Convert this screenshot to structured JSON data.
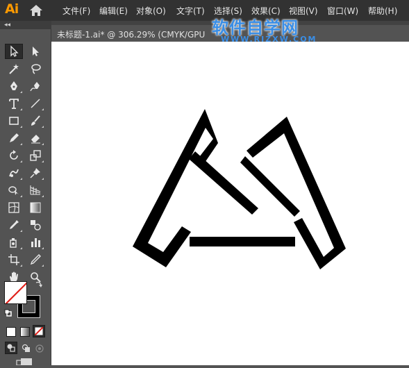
{
  "app": {
    "logo_text": "Ai"
  },
  "menu": {
    "items": [
      {
        "label": "文件(F)"
      },
      {
        "label": "编辑(E)"
      },
      {
        "label": "对象(O)"
      },
      {
        "label": "文字(T)"
      },
      {
        "label": "选择(S)"
      },
      {
        "label": "效果(C)"
      },
      {
        "label": "视图(V)"
      },
      {
        "label": "窗口(W)"
      },
      {
        "label": "帮助(H)"
      }
    ]
  },
  "document": {
    "tab_title": "未标题-1.ai* @ 306.29% (CMYK/GPU"
  },
  "watermark": {
    "main": "软件自学网",
    "url": "WWW.RJZXW.COM"
  },
  "tools_panel": {
    "collapse_glyph": "◂◂"
  },
  "colors": {
    "ui_dark": "#323232",
    "panel": "#535353",
    "logo_orange": "#ff9a00",
    "watermark_blue": "#3a8ee6",
    "none_swatch_red": "#e0201a",
    "artwork": "#000000"
  }
}
